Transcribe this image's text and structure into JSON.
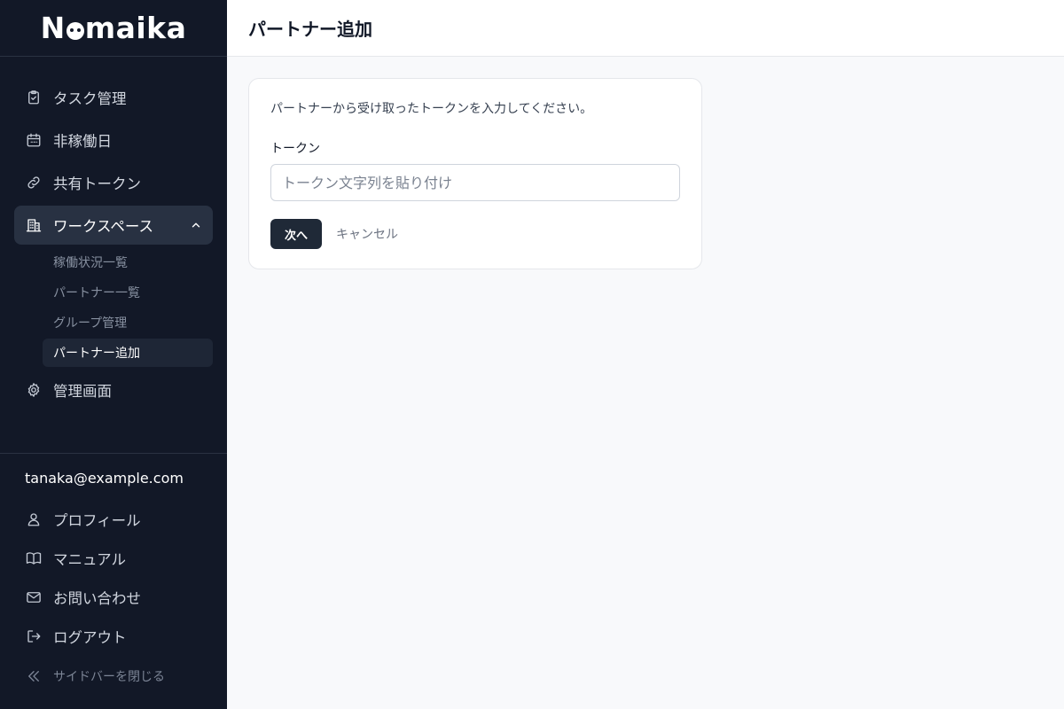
{
  "app": {
    "logo_pre": "N",
    "logo_post": "maika"
  },
  "sidebar": {
    "items": [
      {
        "label": "タスク管理",
        "icon": "clipboard-check-icon"
      },
      {
        "label": "非稼働日",
        "icon": "calendar-icon"
      },
      {
        "label": "共有トークン",
        "icon": "link-icon"
      },
      {
        "label": "ワークスペース",
        "icon": "building-icon",
        "expanded": true
      }
    ],
    "workspace_sub": [
      {
        "label": "稼働状況一覧"
      },
      {
        "label": "パートナー一覧"
      },
      {
        "label": "グループ管理"
      },
      {
        "label": "パートナー追加",
        "active": true
      }
    ],
    "admin": {
      "label": "管理画面",
      "icon": "gear-icon"
    },
    "user_email": "tanaka@example.com",
    "bottom_items": [
      {
        "label": "プロフィール",
        "icon": "user-icon"
      },
      {
        "label": "マニュアル",
        "icon": "book-icon"
      },
      {
        "label": "お問い合わせ",
        "icon": "mail-icon"
      },
      {
        "label": "ログアウト",
        "icon": "logout-icon"
      }
    ],
    "collapse_label": "サイドバーを閉じる"
  },
  "header": {
    "title": "パートナー追加"
  },
  "form": {
    "description": "パートナーから受け取ったトークンを入力してください。",
    "token_label": "トークン",
    "token_value": "",
    "token_placeholder": "トークン文字列を貼り付け",
    "next_label": "次へ",
    "cancel_label": "キャンセル"
  },
  "colors": {
    "sidebar_bg": "#121827",
    "primary_button": "#1f2937",
    "page_bg": "#f8f9fb"
  }
}
